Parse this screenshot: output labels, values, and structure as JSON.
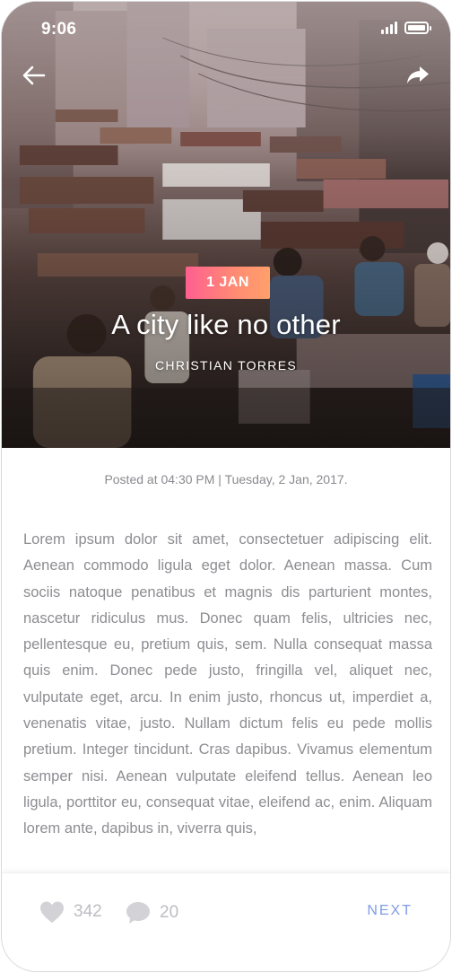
{
  "status_bar": {
    "time": "9:06"
  },
  "hero": {
    "date_badge": "1 JAN",
    "title": "A city like no other",
    "author": "CHRISTIAN TORRES",
    "icons": [
      "back-arrow-icon",
      "share-icon"
    ]
  },
  "post": {
    "posted_at": "Posted at 04:30 PM | Tuesday, 2 Jan, 2017.",
    "body": "Lorem ipsum dolor sit amet, consectetuer adipiscing elit. Aenean commodo ligula eget dolor. Aenean massa. Cum sociis natoque penatibus et magnis dis parturient montes, nascetur ridiculus mus. Donec quam felis, ultricies nec, pellentesque eu, pretium quis, sem. Nulla consequat massa quis enim. Donec pede justo, fringilla vel, aliquet nec, vulputate eget, arcu. In enim justo, rhoncus ut, imperdiet a, venenatis vitae, justo. Nullam dictum felis eu pede mollis pretium. Integer tincidunt. Cras dapibus. Vivamus elementum semper nisi. Aenean vulputate eleifend tellus. Aenean leo ligula, porttitor eu, consequat vitae, eleifend ac, enim. Aliquam lorem ante, dapibus in, viverra quis,"
  },
  "footer": {
    "likes": "342",
    "comments": "20",
    "next_label": "NEXT"
  },
  "colors": {
    "badge_gradient_start": "#ff5f8f",
    "badge_gradient_end": "#ffa06a",
    "next_accent": "#7f9be6",
    "body_text": "#8d8d92"
  }
}
